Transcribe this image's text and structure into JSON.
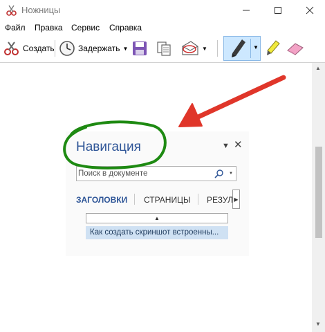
{
  "window": {
    "title": "Ножницы"
  },
  "menu": {
    "items": [
      "Файл",
      "Правка",
      "Сервис",
      "Справка"
    ]
  },
  "toolbar": {
    "new_label": "Создать",
    "delay_label": "Задержать"
  },
  "content": {
    "nav_title": "Навигация",
    "search_placeholder": "Поиск в документе",
    "tabs": [
      "ЗАГОЛОВКИ",
      "СТРАНИЦЫ",
      "РЕЗУЛ"
    ],
    "heading_item": "Как создать скриншот встроенны..."
  },
  "annotations": {
    "circle_color": "#1e8a12",
    "arrow_color": "#e0362a"
  }
}
